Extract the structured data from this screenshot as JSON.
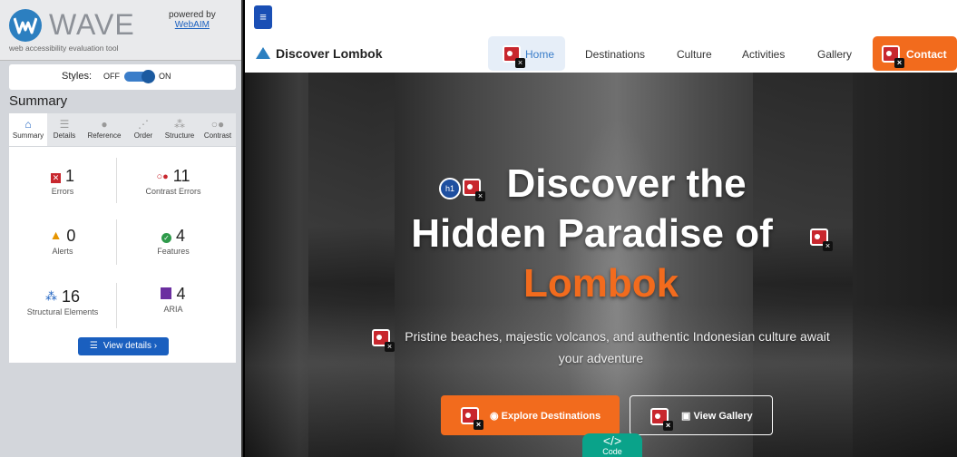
{
  "wave": {
    "title": "WAVE",
    "tagline": "web accessibility evaluation tool",
    "powered_by": "powered by",
    "powered_link": "WebAIM",
    "styles_label": "Styles:",
    "styles_off": "OFF",
    "styles_on": "ON",
    "summary_heading": "Summary",
    "tabs": [
      {
        "label": "Summary",
        "icon": "home-icon"
      },
      {
        "label": "Details",
        "icon": "list-icon"
      },
      {
        "label": "Reference",
        "icon": "info-icon"
      },
      {
        "label": "Order",
        "icon": "order-icon"
      },
      {
        "label": "Structure",
        "icon": "structure-icon"
      },
      {
        "label": "Contrast",
        "icon": "contrast-icon"
      }
    ],
    "stats": [
      {
        "count": "1",
        "label": "Errors",
        "icon": "error-icon",
        "color": "#c8272e"
      },
      {
        "count": "11",
        "label": "Contrast Errors",
        "icon": "contrast-error-icon",
        "color": "#c8272e"
      },
      {
        "count": "0",
        "label": "Alerts",
        "icon": "alert-icon",
        "color": "#e69500"
      },
      {
        "count": "4",
        "label": "Features",
        "icon": "feature-icon",
        "color": "#2e9a4a"
      },
      {
        "count": "16",
        "label": "Structural Elements",
        "icon": "structure-icon",
        "color": "#1a5fbf"
      },
      {
        "count": "4",
        "label": "ARIA",
        "icon": "aria-icon",
        "color": "#6b2fa0"
      }
    ],
    "view_details": "View details ›"
  },
  "site": {
    "brand": "Discover Lombok",
    "nav": [
      "Home",
      "Destinations",
      "Culture",
      "Activities",
      "Gallery"
    ],
    "contact": "Contact",
    "hero_line1": "Discover the",
    "hero_line2": "Hidden Paradise of",
    "hero_line3": "Lombok",
    "h1_badge": "h1",
    "subtitle_line1": "Pristine beaches, majestic volcanos, and authentic Indonesian culture await",
    "subtitle_line2": "your adventure",
    "cta_primary": "Explore Destinations",
    "cta_secondary": "View Gallery",
    "code_tab": "</>",
    "code_tab_label": "Code",
    "accent_color": "#f26b1d"
  }
}
